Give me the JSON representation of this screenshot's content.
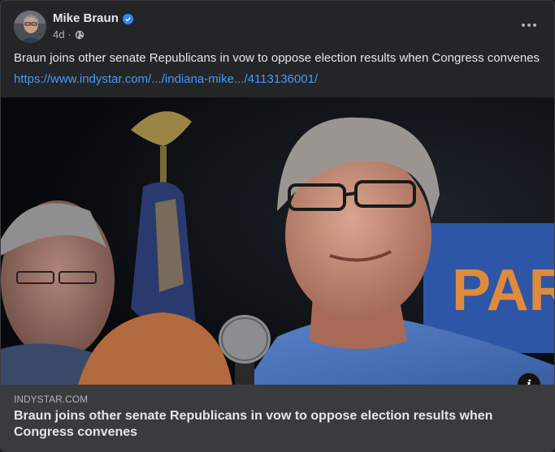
{
  "post": {
    "author": "Mike Braun",
    "time": "4d",
    "separator": "·",
    "text": "Braun joins other senate Republicans in vow to oppose election results when Congress convenes",
    "link_url": "https://www.indystar.com/.../indiana-mike.../4113136001/",
    "icons": {
      "verified": "verified-badge-icon",
      "audience": "globe-icon",
      "more": "more-options-icon",
      "info": "info-icon"
    },
    "colors": {
      "background": "#242526",
      "link": "#4599ff",
      "verified": "#2d88ff",
      "card": "#3a3b3c"
    }
  },
  "link_card": {
    "domain": "INDYSTAR.COM",
    "title": "Braun joins other senate Republicans in vow to oppose election results when Congress convenes",
    "image_sign_text": "PAR"
  }
}
